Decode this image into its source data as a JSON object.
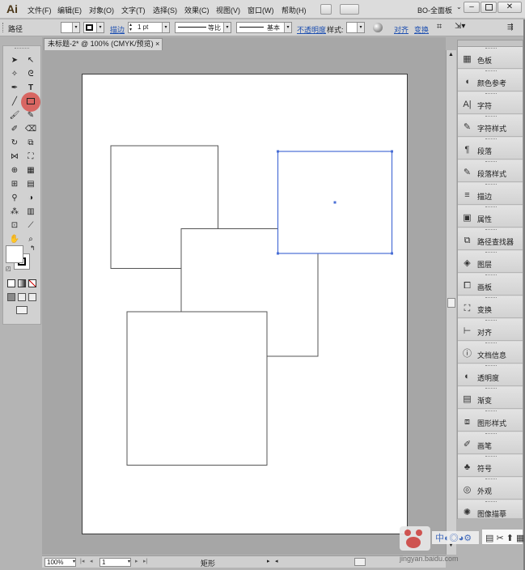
{
  "app": {
    "logo": "Ai",
    "workspace": "BO-全面板"
  },
  "menu": [
    "文件(F)",
    "编辑(E)",
    "对象(O)",
    "文字(T)",
    "选择(S)",
    "效果(C)",
    "视图(V)",
    "窗口(W)",
    "帮助(H)"
  ],
  "control": {
    "selection": "路径",
    "stroke_link": "描边",
    "stroke_weight": "1 pt",
    "profile_label": "等比",
    "brush_label": "基本",
    "opacity_link": "不透明度",
    "style_label": "样式:",
    "align_link": "对齐",
    "transform_link": "变换"
  },
  "document": {
    "tab_title": "未标题-2* @ 100% (CMYK/预览)",
    "close": "×"
  },
  "status": {
    "zoom": "100%",
    "page": "1",
    "tool": "矩形"
  },
  "panels": [
    {
      "label": "色板",
      "icon": "swatches-icon"
    },
    {
      "label": "颜色参考",
      "icon": "color-guide-icon"
    },
    {
      "label": "字符",
      "icon": "character-icon"
    },
    {
      "label": "字符样式",
      "icon": "character-styles-icon"
    },
    {
      "label": "段落",
      "icon": "paragraph-icon"
    },
    {
      "label": "段落样式",
      "icon": "paragraph-styles-icon"
    },
    {
      "label": "描边",
      "icon": "stroke-icon"
    },
    {
      "label": "属性",
      "icon": "attributes-icon"
    },
    {
      "label": "路径查找器",
      "icon": "pathfinder-icon"
    },
    {
      "label": "图层",
      "icon": "layers-icon"
    },
    {
      "label": "画板",
      "icon": "artboards-icon"
    },
    {
      "label": "变换",
      "icon": "transform-icon"
    },
    {
      "label": "对齐",
      "icon": "align-icon"
    },
    {
      "label": "文档信息",
      "icon": "document-info-icon"
    },
    {
      "label": "透明度",
      "icon": "transparency-icon"
    },
    {
      "label": "渐变",
      "icon": "gradient-icon"
    },
    {
      "label": "图形样式",
      "icon": "graphic-styles-icon"
    },
    {
      "label": "画笔",
      "icon": "brushes-icon"
    },
    {
      "label": "符号",
      "icon": "symbols-icon"
    },
    {
      "label": "外观",
      "icon": "appearance-icon"
    },
    {
      "label": "图像描摹",
      "icon": "image-trace-icon"
    }
  ],
  "watermark": {
    "url": "jingyan.baidu.com"
  },
  "colors": {
    "selection": "#4a6fd6",
    "tool_highlight": "#d9534f",
    "logo_bg": "#4a3617"
  }
}
